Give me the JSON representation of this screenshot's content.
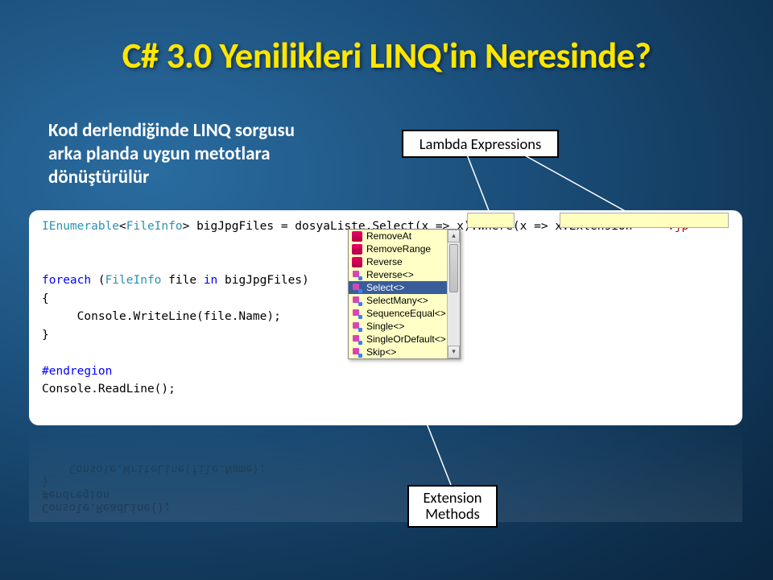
{
  "title": "C# 3.0 Yenilikleri LINQ'in Neresinde?",
  "subtitle": "Kod derlendiğinde LINQ sorgusu arka planda uygun metotlara dönüştürülür",
  "labels": {
    "lambda": "Lambda Expressions",
    "extension": "Extension Methods"
  },
  "code": {
    "line1_prefix": "IEnumerable",
    "line1_generic_open": "<",
    "line1_type": "FileInfo",
    "line1_generic_close": ">",
    "line1_rest": " bigJpgFiles = dosyaListe.Select(",
    "line1_lambda1": "x => x",
    "line1_mid": ").Where(",
    "line1_lambda2": "x => x.Extension == ",
    "line1_str": "\".jp",
    "foreach_kw": "foreach",
    "foreach_rest1": " (",
    "foreach_type": "FileInfo",
    "foreach_rest2": " file ",
    "in_kw": "in",
    "foreach_rest3": " bigJpgFiles)",
    "brace_open": "{",
    "console_call": "     Console.WriteLine(file.Name);",
    "brace_close": "}",
    "endregion": "#endregion",
    "readline": "Console.ReadLine();"
  },
  "intellisense": {
    "items": [
      {
        "name": "RemoveAt",
        "type": "m"
      },
      {
        "name": "RemoveRange",
        "type": "m"
      },
      {
        "name": "Reverse",
        "type": "m"
      },
      {
        "name": "Reverse<>",
        "type": "e"
      },
      {
        "name": "Select<>",
        "type": "e",
        "selected": true
      },
      {
        "name": "SelectMany<>",
        "type": "e"
      },
      {
        "name": "SequenceEqual<>",
        "type": "e"
      },
      {
        "name": "Single<>",
        "type": "e"
      },
      {
        "name": "SingleOrDefault<>",
        "type": "e"
      },
      {
        "name": "Skip<>",
        "type": "e"
      }
    ]
  }
}
